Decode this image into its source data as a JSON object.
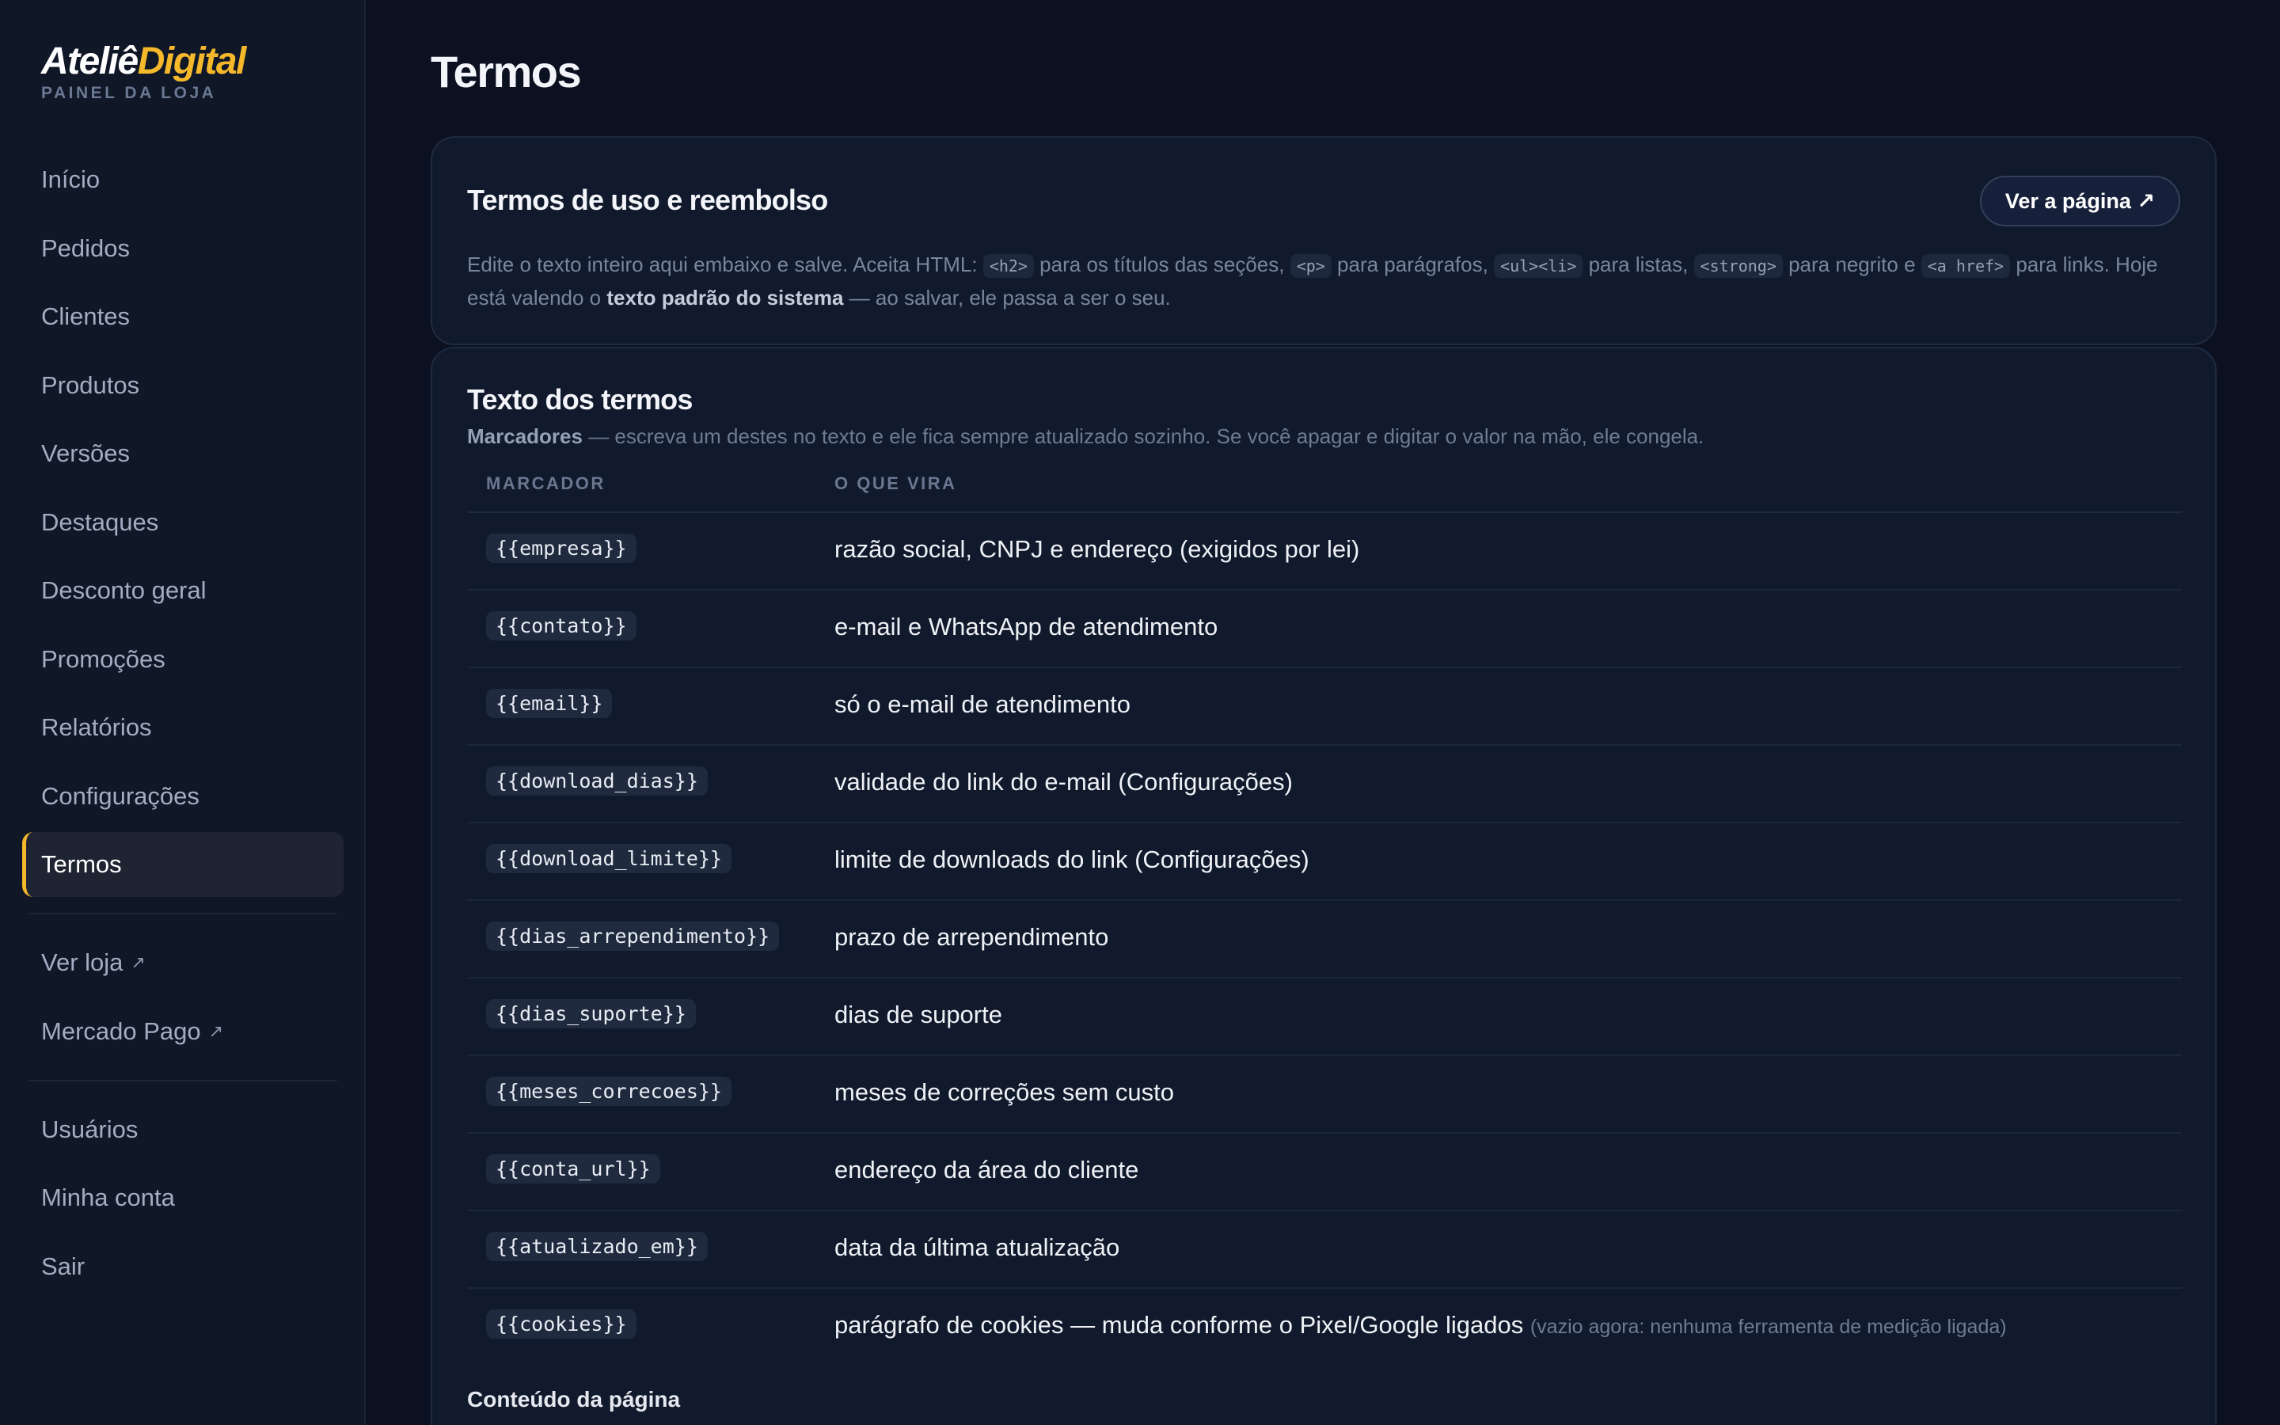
{
  "brand": {
    "name_part1": "Ateliê",
    "name_part2": "Digital",
    "subtitle": "PAINEL DA LOJA"
  },
  "nav": {
    "items": [
      {
        "label": "Início"
      },
      {
        "label": "Pedidos"
      },
      {
        "label": "Clientes"
      },
      {
        "label": "Produtos"
      },
      {
        "label": "Versões"
      },
      {
        "label": "Destaques"
      },
      {
        "label": "Desconto geral"
      },
      {
        "label": "Promoções"
      },
      {
        "label": "Relatórios"
      },
      {
        "label": "Configurações"
      },
      {
        "label": "Termos",
        "active": true
      }
    ],
    "external": [
      {
        "label": "Ver loja",
        "icon": "↗"
      },
      {
        "label": "Mercado Pago",
        "icon": "↗"
      }
    ],
    "account": [
      {
        "label": "Usuários"
      },
      {
        "label": "Minha conta"
      },
      {
        "label": "Sair"
      }
    ]
  },
  "page": {
    "title": "Termos"
  },
  "terms_card": {
    "title": "Termos de uso e reembolso",
    "view_button": "Ver a página ↗",
    "desc": {
      "t1": "Edite o texto inteiro aqui embaixo e salve. Aceita HTML: ",
      "c1": "<h2>",
      "t2": " para os títulos das seções, ",
      "c2": "<p>",
      "t3": " para parágrafos, ",
      "c3": "<ul><li>",
      "t4": " para listas, ",
      "c4": "<strong>",
      "t5": " para negrito e ",
      "c5": "<a href>",
      "t6": " para links. Hoje está valendo o ",
      "strong": "texto padrão do sistema",
      "t7": " — ao salvar, ele passa a ser o seu."
    }
  },
  "text_card": {
    "title": "Texto dos termos",
    "markers_label": "Marcadores",
    "markers_desc": " — escreva um destes no texto e ele fica sempre atualizado sozinho. Se você apagar e digitar o valor na mão, ele congela.",
    "col_marker": "MARCADOR",
    "col_value": "O QUE VIRA",
    "rows": [
      {
        "key": "{{empresa}}",
        "value": "razão social, CNPJ e endereço (exigidos por lei)",
        "note": ""
      },
      {
        "key": "{{contato}}",
        "value": "e-mail e WhatsApp de atendimento",
        "note": ""
      },
      {
        "key": "{{email}}",
        "value": "só o e-mail de atendimento",
        "note": ""
      },
      {
        "key": "{{download_dias}}",
        "value": "validade do link do e-mail (Configurações)",
        "note": ""
      },
      {
        "key": "{{download_limite}}",
        "value": "limite de downloads do link (Configurações)",
        "note": ""
      },
      {
        "key": "{{dias_arrependimento}}",
        "value": "prazo de arrependimento",
        "note": ""
      },
      {
        "key": "{{dias_suporte}}",
        "value": "dias de suporte",
        "note": ""
      },
      {
        "key": "{{meses_correcoes}}",
        "value": "meses de correções sem custo",
        "note": ""
      },
      {
        "key": "{{conta_url}}",
        "value": "endereço da área do cliente",
        "note": ""
      },
      {
        "key": "{{atualizado_em}}",
        "value": "data da última atualização",
        "note": ""
      },
      {
        "key": "{{cookies}}",
        "value": "parágrafo de cookies — muda conforme o Pixel/Google ligados",
        "note": "(vazio agora: nenhuma ferramenta de medição ligada)"
      }
    ],
    "content_label": "Conteúdo da página"
  },
  "colors": {
    "accent": "#f5b82a",
    "background": "#0b1120",
    "sidebar": "#101827",
    "card": "#111a2c"
  }
}
